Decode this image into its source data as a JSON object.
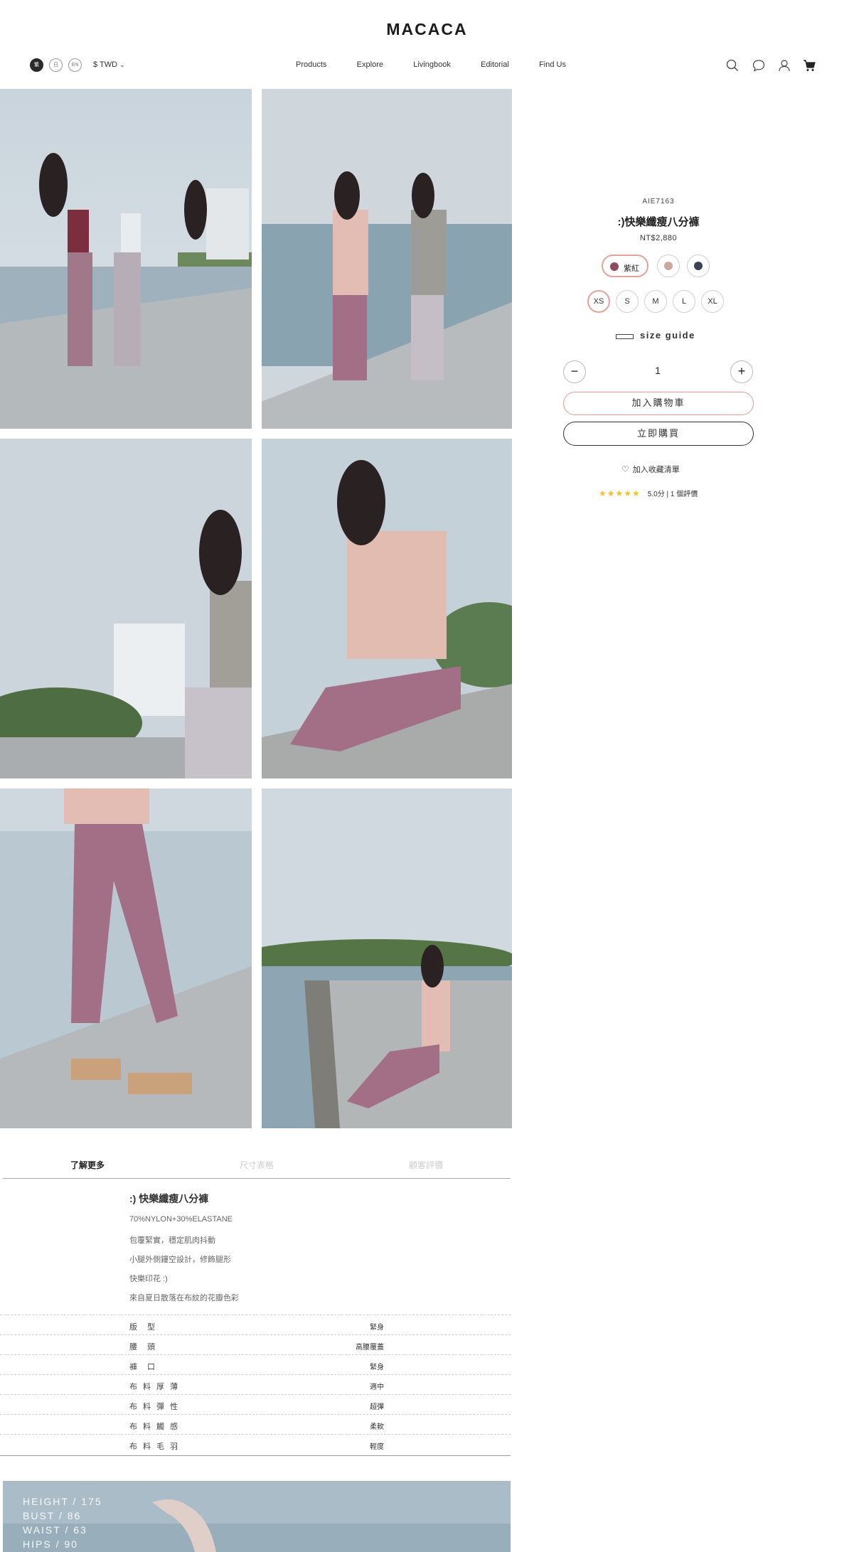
{
  "brand": "MACACA",
  "header": {
    "languages": [
      "繁",
      "日",
      "EN"
    ],
    "currency": "$ TWD",
    "nav": [
      "Products",
      "Explore",
      "Livingbook",
      "Editorial",
      "Find Us"
    ],
    "icons": [
      "search-icon",
      "chat-icon",
      "account-icon",
      "cart-icon"
    ]
  },
  "product": {
    "sku": "AIE7163",
    "name": ":)快樂纖瘦八分褲",
    "price": "NT$2,880",
    "colors": [
      {
        "label": "紫紅",
        "hex": "#8f4a64",
        "selected": true
      },
      {
        "label": "",
        "hex": "#cba79c",
        "selected": false
      },
      {
        "label": "",
        "hex": "#3c4355",
        "selected": false
      }
    ],
    "sizes": [
      {
        "label": "XS",
        "selected": true
      },
      {
        "label": "S",
        "selected": false
      },
      {
        "label": "M",
        "selected": false
      },
      {
        "label": "L",
        "selected": false
      },
      {
        "label": "XL",
        "selected": false
      }
    ],
    "size_guide": "size guide",
    "quantity": "1",
    "minus": "−",
    "plus": "+",
    "add_to_cart": "加入購物車",
    "buy_now": "立即購買",
    "wishlist": "加入收藏清單",
    "rating": {
      "stars": "★★★★★",
      "text": "5.0分 | 1 個評價"
    }
  },
  "tabs": [
    "了解更多",
    "尺寸表格",
    "顧客評價"
  ],
  "description": {
    "title": ":) 快樂纖瘦八分褲",
    "lines": [
      "70%NYLON+30%ELASTANE",
      "包覆緊實，穩定肌肉抖動",
      "小腿外側鏤空設計，修飾腿形",
      "快樂印花 :)",
      "來自夏日散落在布紋的花瓣色彩"
    ]
  },
  "specs": [
    {
      "key": "版型",
      "value": "緊身"
    },
    {
      "key": "腰頭",
      "value": "高腰覆蓋"
    },
    {
      "key": "褲口",
      "value": "緊身"
    },
    {
      "key": "布料厚薄",
      "value": "適中"
    },
    {
      "key": "布料彈性",
      "value": "超彈"
    },
    {
      "key": "布料觸感",
      "value": "柔軟"
    },
    {
      "key": "布料毛羽",
      "value": "輕度"
    }
  ],
  "model": {
    "stats": [
      "HEIGHT / 175",
      "BUST / 86",
      "WAIST / 63",
      "HIPS / 90"
    ]
  }
}
